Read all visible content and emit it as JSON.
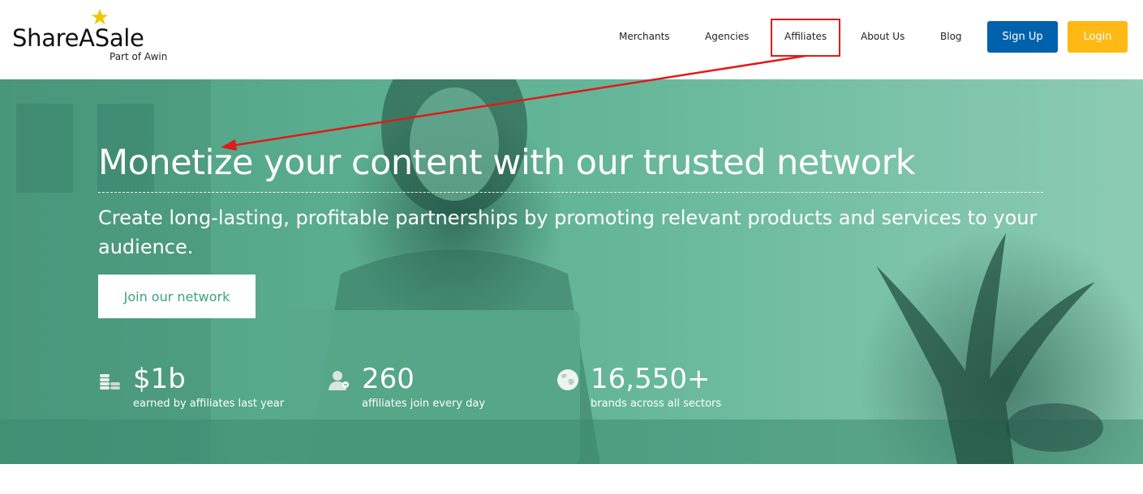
{
  "logo": {
    "name": "ShareASale",
    "sub": "Part of Awin"
  },
  "nav": {
    "items": [
      "Merchants",
      "Agencies",
      "Affiliates",
      "About Us",
      "Blog"
    ],
    "signup": "Sign Up",
    "login": "Login"
  },
  "hero": {
    "title": "Monetize your content with our trusted network",
    "subtitle": "Create long-lasting, profitable partnerships by promoting relevant products and services to your audience.",
    "cta": "Join our network"
  },
  "stats": [
    {
      "icon": "coins-stack-icon",
      "value": "$1b",
      "label": "earned by affiliates last year"
    },
    {
      "icon": "person-add-icon",
      "value": "260",
      "label": "affiliates join every day"
    },
    {
      "icon": "globe-icon",
      "value": "16,550+",
      "label": "brands across all sectors"
    }
  ],
  "colors": {
    "signup_bg": "#0062ad",
    "login_bg": "#ffb814",
    "hero_green": "#5aad8f",
    "annotation_red": "#e11a1a",
    "star_yellow": "#f2c500"
  }
}
